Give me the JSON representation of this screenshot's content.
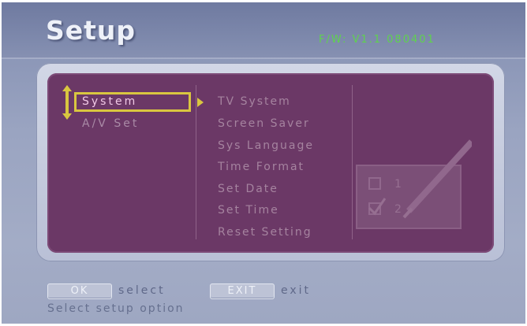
{
  "header": {
    "title": "Setup",
    "firmware": "F/W: V1.1 080401"
  },
  "left_menu": {
    "items": [
      {
        "label": "System",
        "selected": true
      },
      {
        "label": "A/V Set",
        "selected": false
      }
    ]
  },
  "right_menu": {
    "items": [
      {
        "label": "TV System"
      },
      {
        "label": "Screen Saver"
      },
      {
        "label": "Sys Language"
      },
      {
        "label": "Time Format"
      },
      {
        "label": "Set Date"
      },
      {
        "label": "Set Time"
      },
      {
        "label": "Reset Setting"
      }
    ]
  },
  "watermark": {
    "option1": "1",
    "option2": "2"
  },
  "footer": {
    "ok_key": "OK",
    "ok_action": "select",
    "exit_key": "EXIT",
    "exit_action": "exit",
    "hint": "Select setup option"
  },
  "colors": {
    "panel": "#6b3866",
    "selection": "#d9c640",
    "firmware_text": "#5fd24e"
  }
}
